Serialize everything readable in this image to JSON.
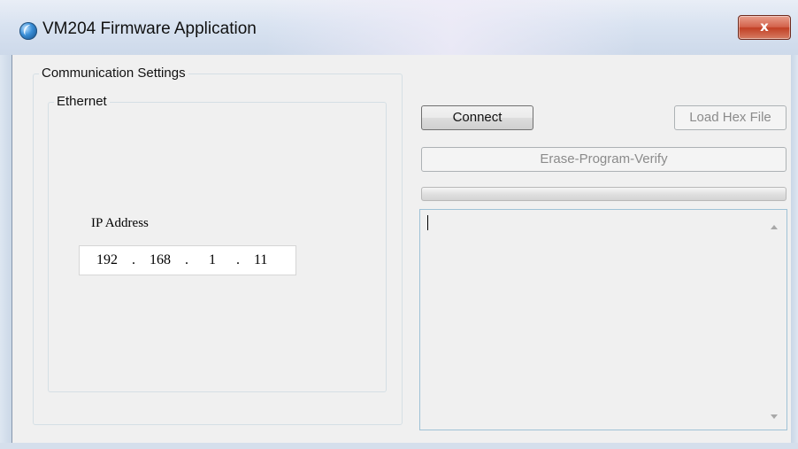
{
  "window": {
    "title": "VM204 Firmware Application",
    "close_label": "x",
    "icon": "globe-app-icon"
  },
  "communication": {
    "group_label": "Communication Settings",
    "ethernet_label": "Ethernet",
    "ip_label": "IP Address",
    "ip": [
      "192",
      "168",
      "1",
      "11"
    ],
    "separator": "."
  },
  "actions": {
    "connect_label": "Connect",
    "load_hex_label": "Load Hex File",
    "erase_program_verify_label": "Erase-Program-Verify"
  },
  "progress": {
    "value": 0
  },
  "log": {
    "text": ""
  },
  "colors": {
    "dialog_bg": "#f0f0f0",
    "close_button": "#c13f24",
    "log_border": "#9fc2d6"
  }
}
